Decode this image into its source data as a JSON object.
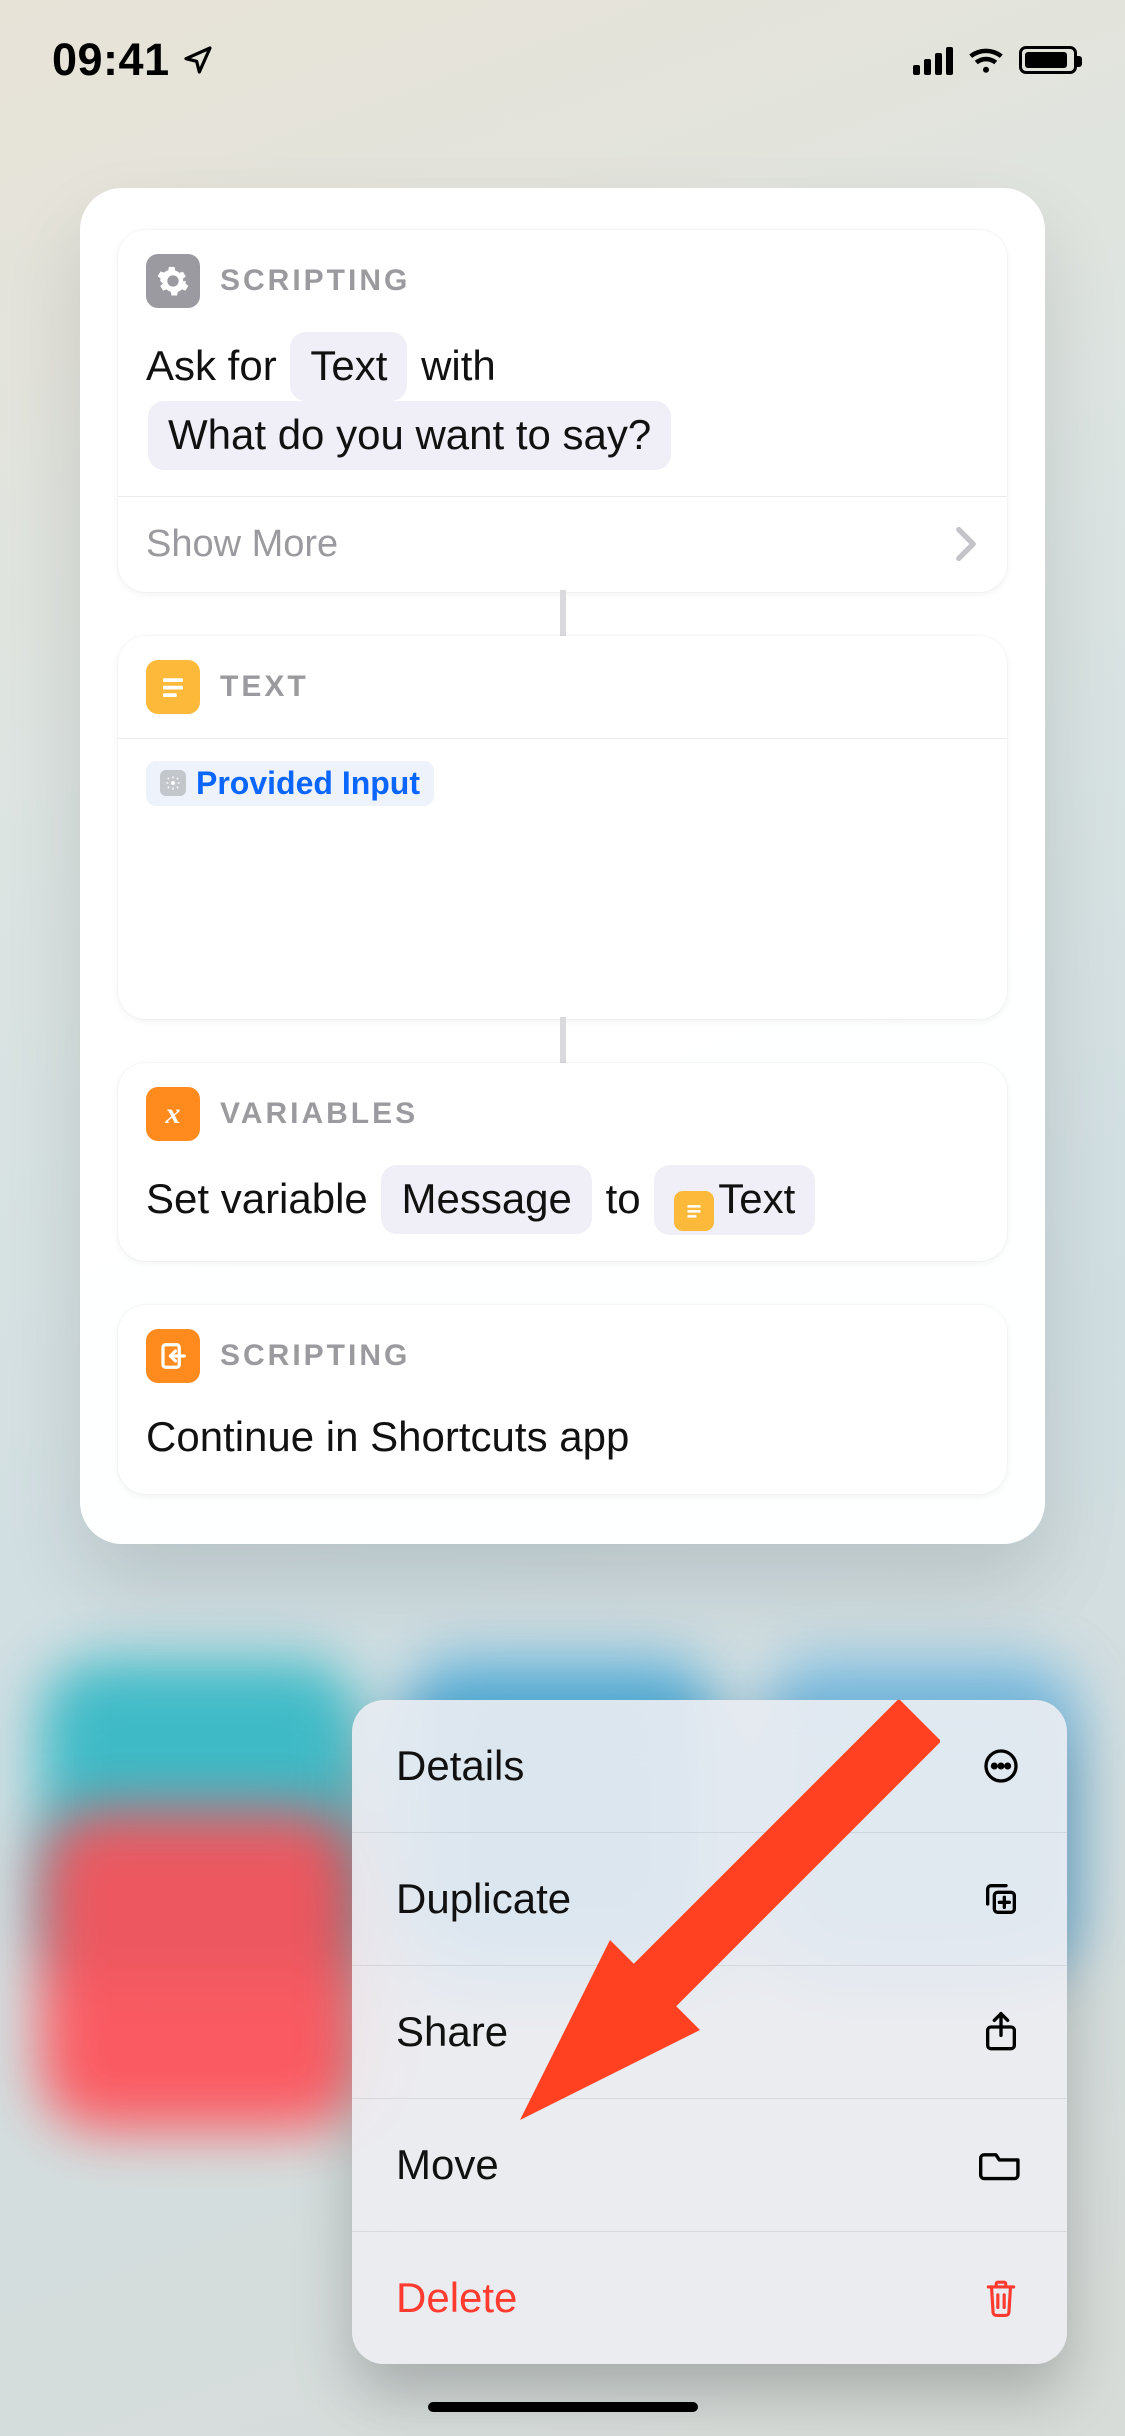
{
  "status": {
    "time": "09:41"
  },
  "cards": {
    "ask": {
      "category": "SCRIPTING",
      "prefix": "Ask for",
      "type_token": "Text",
      "mid": "with",
      "prompt_token": "What do you want to say?",
      "show_more": "Show More"
    },
    "text": {
      "category": "TEXT",
      "variable": "Provided Input"
    },
    "setvar": {
      "category": "VARIABLES",
      "prefix": "Set variable",
      "name_token": "Message",
      "mid": "to",
      "value_token": "Text"
    },
    "continue": {
      "category": "SCRIPTING",
      "title": "Continue in Shortcuts app"
    }
  },
  "menu": {
    "details": "Details",
    "duplicate": "Duplicate",
    "share": "Share",
    "move": "Move",
    "delete": "Delete"
  },
  "colors": {
    "destructive": "#ff3b30"
  }
}
